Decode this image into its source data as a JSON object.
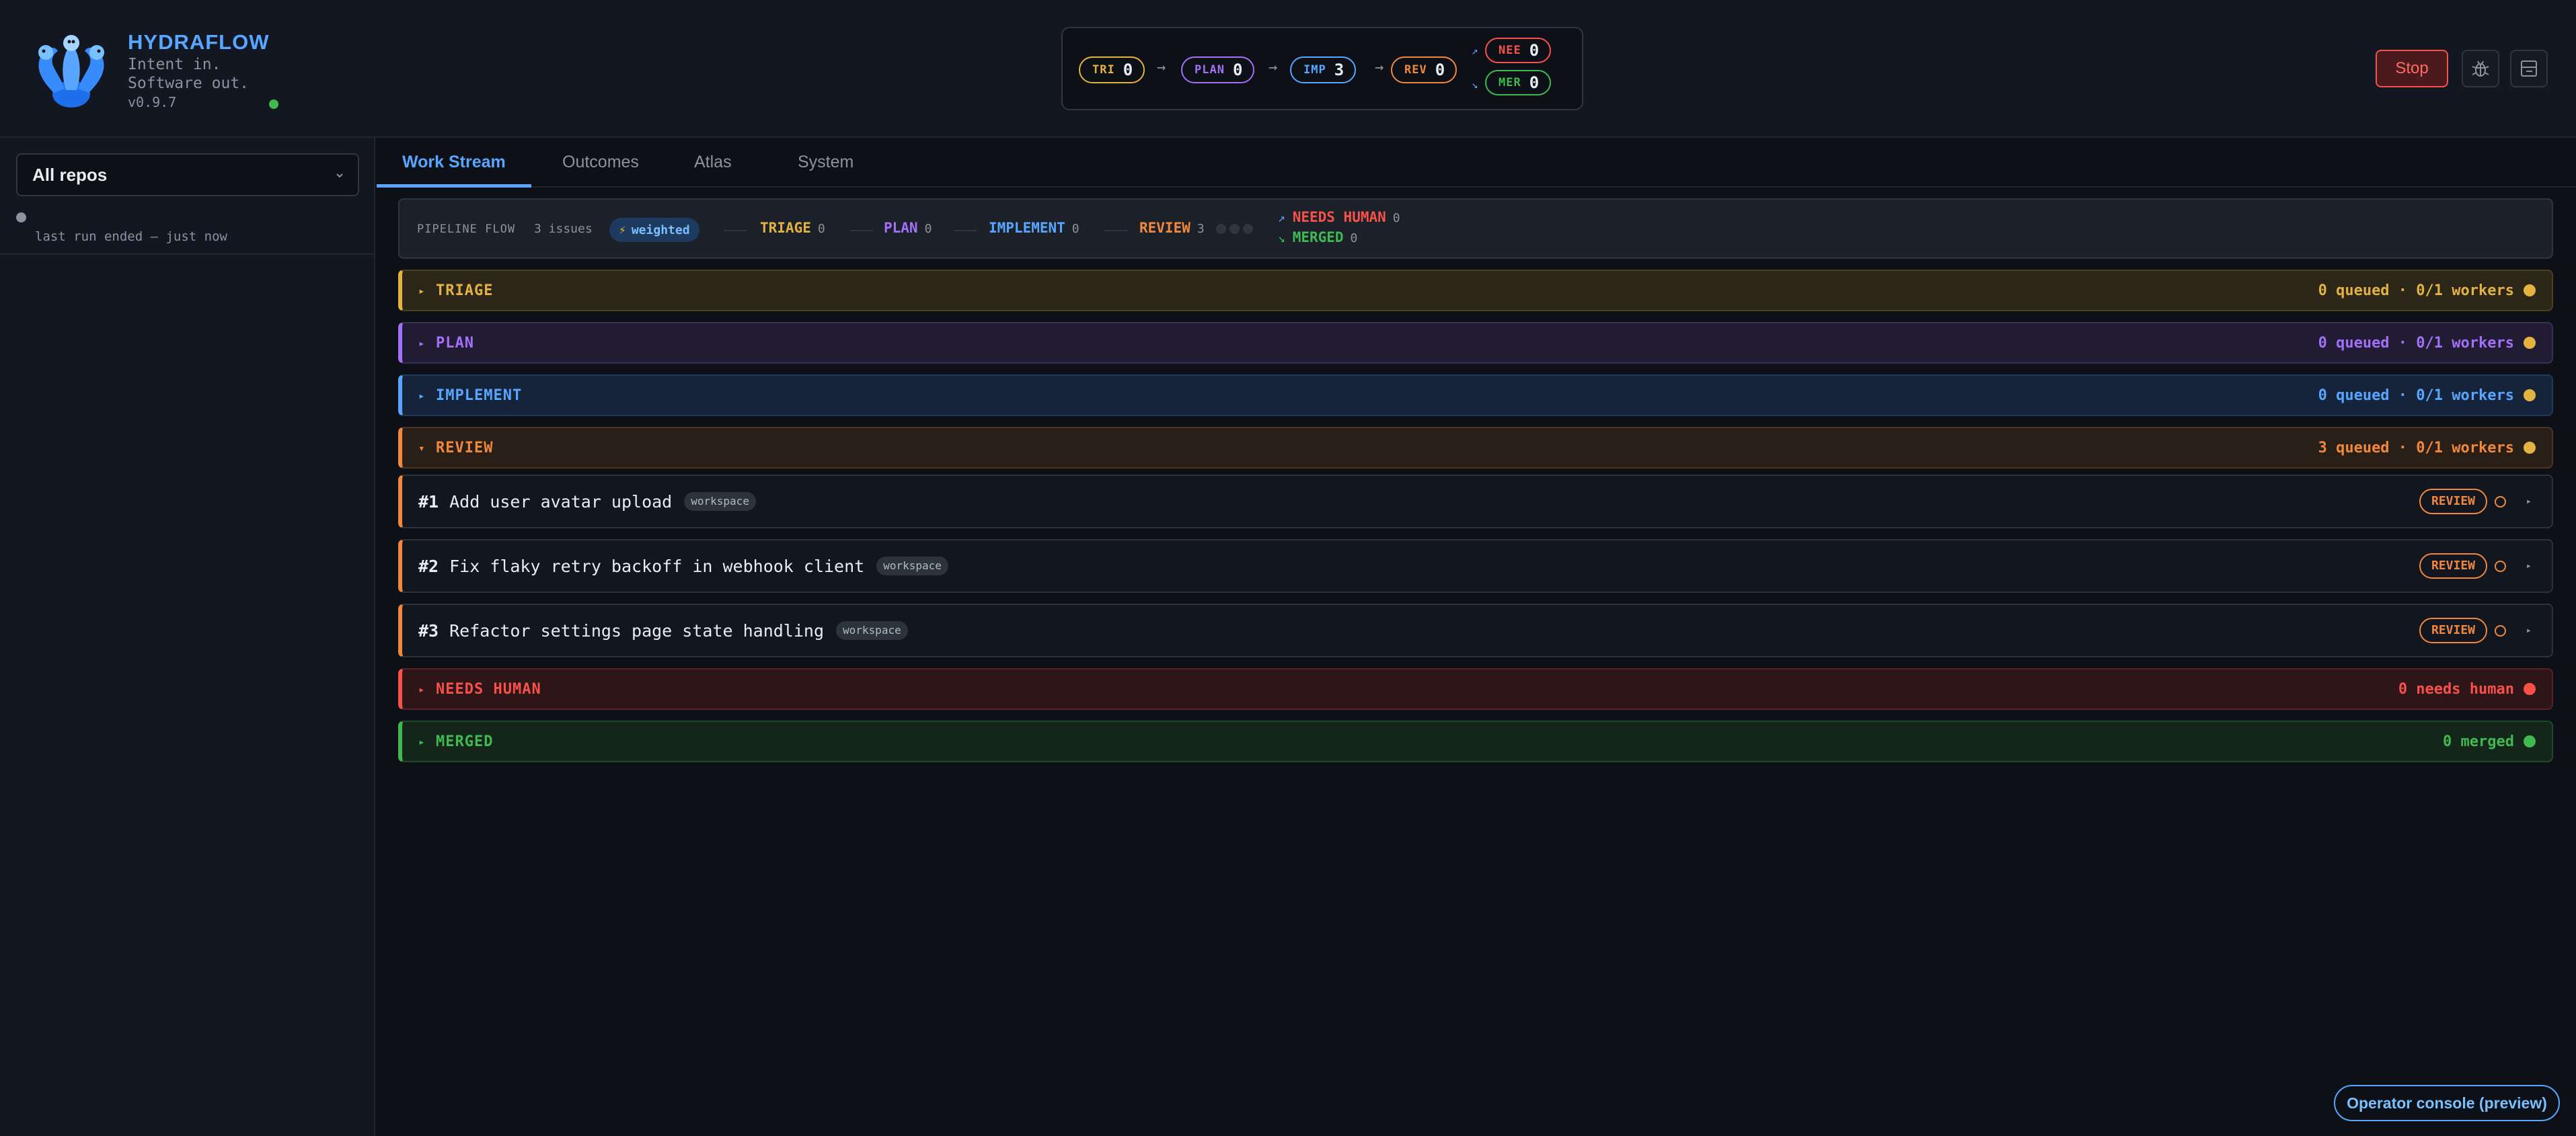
{
  "brand": {
    "name": "HYDRAFLOW",
    "tagline_1": "Intent in.",
    "tagline_2": "Software out.",
    "version": "v0.9.7"
  },
  "top_flow": {
    "triage": {
      "label": "TRI",
      "value": "0"
    },
    "plan": {
      "label": "PLAN",
      "value": "0"
    },
    "implement": {
      "label": "IMP",
      "value": "3"
    },
    "review": {
      "label": "REV",
      "value": "0"
    },
    "needs_human": {
      "label": "NEE",
      "value": "0"
    },
    "merged": {
      "label": "MER",
      "value": "0"
    }
  },
  "header_actions": {
    "stop_label": "Stop",
    "bug_icon": "bug-icon",
    "panel_icon": "panel-icon"
  },
  "sidebar": {
    "repo_select": "All repos",
    "run_status": "last run ended — just now"
  },
  "tabs": [
    "Work Stream",
    "Outcomes",
    "Atlas",
    "System"
  ],
  "summary": {
    "title": "PIPELINE FLOW",
    "issues": "3 issues",
    "weighted": "weighted",
    "triage": {
      "label": "TRIAGE",
      "count": "0"
    },
    "plan": {
      "label": "PLAN",
      "count": "0"
    },
    "implement": {
      "label": "IMPLEMENT",
      "count": "0"
    },
    "review": {
      "label": "REVIEW",
      "count": "3"
    },
    "needs_human": {
      "label": "NEEDS HUMAN",
      "count": "0"
    },
    "merged": {
      "label": "MERGED",
      "count": "0"
    }
  },
  "stages": {
    "triage": {
      "name": "TRIAGE",
      "status": "0 queued · 0/1 workers"
    },
    "plan": {
      "name": "PLAN",
      "status": "0 queued · 0/1 workers"
    },
    "implement": {
      "name": "IMPLEMENT",
      "status": "0 queued · 0/1 workers"
    },
    "review": {
      "name": "REVIEW",
      "status": "3 queued · 0/1 workers"
    },
    "needs_human": {
      "name": "NEEDS HUMAN",
      "status": "0 needs human"
    },
    "merged": {
      "name": "MERGED",
      "status": "0 merged"
    }
  },
  "issues": [
    {
      "number": "#1",
      "title": "Add user avatar upload",
      "tag": "workspace",
      "status": "REVIEW"
    },
    {
      "number": "#2",
      "title": "Fix flaky retry backoff in webhook client",
      "tag": "workspace",
      "status": "REVIEW"
    },
    {
      "number": "#3",
      "title": "Refactor settings page state handling",
      "tag": "workspace",
      "status": "REVIEW"
    }
  ],
  "console_button": "Operator console (preview)",
  "colors": {
    "triage": "#e3b341",
    "plan": "#a371f7",
    "implement": "#58a6ff",
    "review": "#f0883e",
    "needs_human": "#f85149",
    "merged": "#3fb950"
  }
}
